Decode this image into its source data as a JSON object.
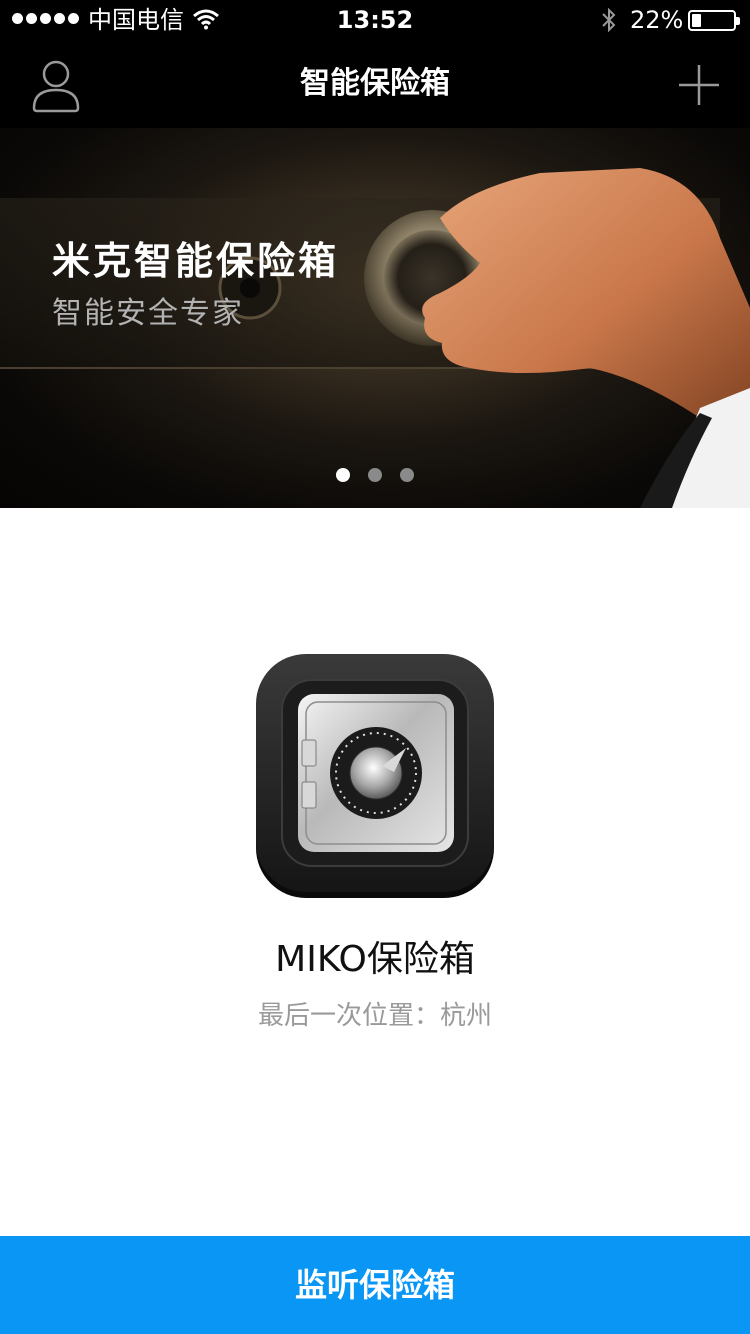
{
  "status_bar": {
    "carrier": "中国电信",
    "time": "13:52",
    "battery_pct": "22%",
    "battery_level": 0.22
  },
  "nav": {
    "title": "智能保险箱",
    "left_icon": "user-icon",
    "right_icon": "plus-icon"
  },
  "banner": {
    "title": "米克智能保险箱",
    "subtitle": "智能安全专家",
    "slide_count": 3,
    "active_slide": 1
  },
  "device": {
    "icon": "safe-icon",
    "name": "MIKO保险箱",
    "location": "最后一次位置：杭州"
  },
  "action": {
    "label": "监听保险箱"
  },
  "colors": {
    "accent": "#0a96f5",
    "bar": "#000000"
  }
}
